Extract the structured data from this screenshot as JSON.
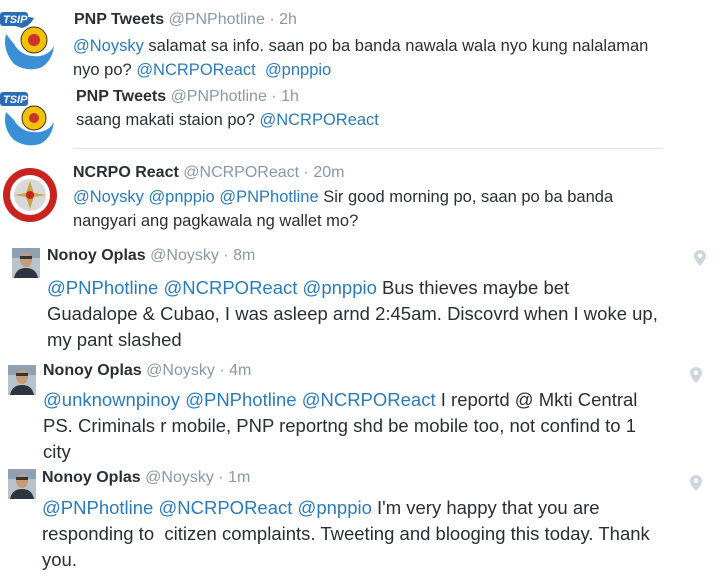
{
  "tweets": [
    {
      "name": "PNP Tweets",
      "handle": "@PNPhotline",
      "sep": "·",
      "time": "2h",
      "avatar": "pnp-tsip-logo",
      "lines": [
        [
          {
            "m": "@Noysky"
          },
          {
            "t": " salamat sa info. saan po ba banda nawala wala nyo kung nalalaman"
          }
        ],
        [
          {
            "t": "nyo po? "
          },
          {
            "m": "@NCRPOReact"
          },
          {
            "t": "  "
          },
          {
            "m": "@pnppio"
          }
        ]
      ]
    },
    {
      "name": "PNP Tweets",
      "handle": "@PNPhotline",
      "sep": "·",
      "time": "1h",
      "avatar": "pnp-tsip-logo",
      "lines": [
        [
          {
            "t": "saang makati staion po? "
          },
          {
            "m": "@NCRPOReact"
          }
        ]
      ]
    },
    {
      "name": "NCRPO React",
      "handle": "@NCRPOReact",
      "sep": "·",
      "time": "20m",
      "avatar": "ncrpo-seal",
      "lines": [
        [
          {
            "m": "@Noysky"
          },
          {
            "t": " "
          },
          {
            "m": "@pnppio"
          },
          {
            "t": " "
          },
          {
            "m": "@PNPhotline"
          },
          {
            "t": " Sir good morning po, saan po ba banda"
          }
        ],
        [
          {
            "t": "nangyari ang pagkawala ng wallet mo?"
          }
        ]
      ]
    },
    {
      "name": "Nonoy Oplas",
      "handle": "@Noysky",
      "sep": "·",
      "time": "8m",
      "avatar": "user-photo",
      "lines": [
        [
          {
            "m": "@PNPhotline"
          },
          {
            "t": " "
          },
          {
            "m": "@NCRPOReact"
          },
          {
            "t": " "
          },
          {
            "m": "@pnppio"
          },
          {
            "t": " Bus thieves maybe bet"
          }
        ],
        [
          {
            "t": "Guadalope & Cubao, I was asleep arnd 2:45am. Discovrd when I woke up,"
          }
        ],
        [
          {
            "t": "my pant slashed"
          }
        ]
      ]
    },
    {
      "name": "Nonoy Oplas",
      "handle": "@Noysky",
      "sep": "·",
      "time": "4m",
      "avatar": "user-photo",
      "lines": [
        [
          {
            "m": "@unknownpinoy"
          },
          {
            "t": " "
          },
          {
            "m": "@PNPhotline"
          },
          {
            "t": " "
          },
          {
            "m": "@NCRPOReact"
          },
          {
            "t": " I reportd @ Mkti Central"
          }
        ],
        [
          {
            "t": "PS. Criminals r mobile, PNP reportng shd be mobile too, not confind to 1"
          }
        ],
        [
          {
            "t": "city"
          }
        ]
      ]
    },
    {
      "name": "Nonoy Oplas",
      "handle": "@Noysky",
      "sep": "·",
      "time": "1m",
      "avatar": "user-photo",
      "lines": [
        [
          {
            "m": "@PNPhotline"
          },
          {
            "t": " "
          },
          {
            "m": "@NCRPOReact"
          },
          {
            "t": " "
          },
          {
            "m": "@pnppio"
          },
          {
            "t": " I'm very happy that you are"
          }
        ],
        [
          {
            "t": "responding to  citizen complaints. Tweeting and blooging this today. Thank"
          }
        ],
        [
          {
            "t": "you."
          }
        ]
      ]
    }
  ],
  "colors": {
    "mention": "#2b7bb9",
    "meta": "#8899a6",
    "text": "#292f33",
    "divider": "#e1e8ed"
  },
  "icons": {
    "location": "location-pin-icon"
  }
}
